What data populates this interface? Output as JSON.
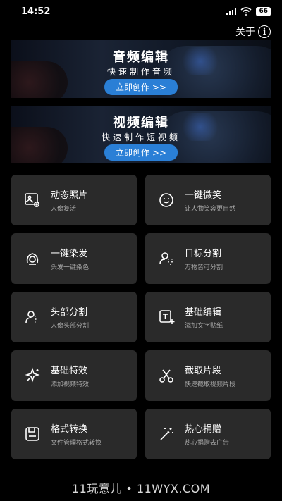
{
  "status_bar": {
    "time": "14:52",
    "battery": "66"
  },
  "top_bar": {
    "about_label": "关于"
  },
  "banners": [
    {
      "title": "音频编辑",
      "subtitle": "快速制作音频",
      "button": "立即创作 >>"
    },
    {
      "title": "视频编辑",
      "subtitle": "快速制作短视频",
      "button": "立即创作 >>"
    }
  ],
  "features": [
    {
      "title": "动态照片",
      "subtitle": "人像复活",
      "icon": "photo-icon"
    },
    {
      "title": "一键微笑",
      "subtitle": "让人物笑容更自然",
      "icon": "smile-icon"
    },
    {
      "title": "一键染发",
      "subtitle": "头发一键染色",
      "icon": "hair-dye-icon"
    },
    {
      "title": "目标分割",
      "subtitle": "万物皆可分割",
      "icon": "target-split-icon"
    },
    {
      "title": "头部分割",
      "subtitle": "人像头部分割",
      "icon": "head-split-icon"
    },
    {
      "title": "基础编辑",
      "subtitle": "添加文字贴纸",
      "icon": "text-add-icon"
    },
    {
      "title": "基础特效",
      "subtitle": "添加视频特效",
      "icon": "sparkle-icon"
    },
    {
      "title": "截取片段",
      "subtitle": "快速截取视频片段",
      "icon": "scissors-icon"
    },
    {
      "title": "格式转换",
      "subtitle": "文件管理格式转换",
      "icon": "save-icon"
    },
    {
      "title": "热心捐赠",
      "subtitle": "热心捐赠去广告",
      "icon": "magic-wand-icon"
    }
  ],
  "watermark": "11玩意儿 • 11WYX.COM"
}
